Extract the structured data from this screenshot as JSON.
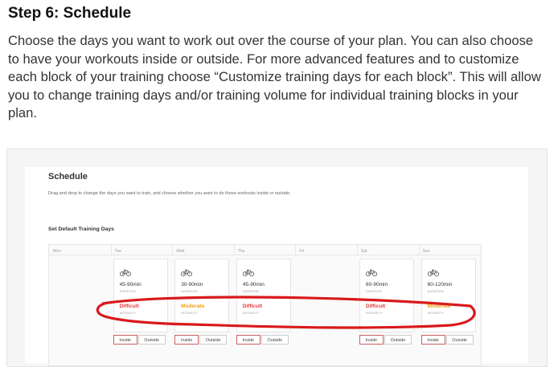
{
  "step": {
    "title": "Step 6: Schedule",
    "description": "Choose the days you want to work out over the course of your plan.  You can also choose to have your workouts inside or outside. For more advanced features and to customize each block of your training choose “Customize training days for each block”.  This will allow you to change training days and/or training volume for individual training blocks in your plan."
  },
  "schedule": {
    "title": "Schedule",
    "description": "Drag and drop to change the days you want to train, and choose whether you want to do those workouts inside or outside.",
    "subtitle": "Set Default Training Days",
    "days": [
      {
        "name": "Mon",
        "has_workout": false
      },
      {
        "name": "Tue",
        "has_workout": true,
        "duration": "45-90min",
        "intensity": "Difficult",
        "intensity_color": "#e53935"
      },
      {
        "name": "Wed",
        "has_workout": true,
        "duration": "30-90min",
        "intensity": "Moderate",
        "intensity_color": "#f39c12"
      },
      {
        "name": "Thu",
        "has_workout": true,
        "duration": "45-90min",
        "intensity": "Difficult",
        "intensity_color": "#e53935"
      },
      {
        "name": "Fri",
        "has_workout": false
      },
      {
        "name": "Sat",
        "has_workout": true,
        "duration": "60-90min",
        "intensity": "Difficult",
        "intensity_color": "#e53935"
      },
      {
        "name": "Sun",
        "has_workout": true,
        "duration": "60-120min",
        "intensity": "Moderate",
        "intensity_color": "#f39c12"
      }
    ],
    "duration_label": "DURATION",
    "intensity_label": "INTENSITY",
    "inside_label": "Inside",
    "outside_label": "Outside",
    "bike_icon": "bicycle-icon"
  },
  "annotation": {
    "color": "#d9191c"
  }
}
